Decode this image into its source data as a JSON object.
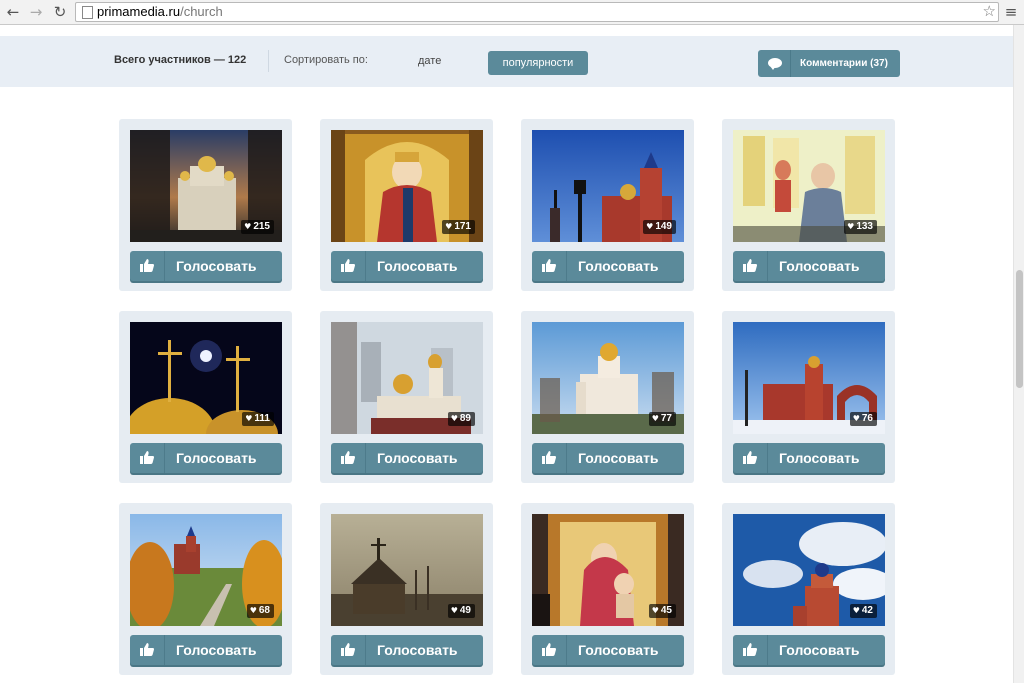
{
  "browser": {
    "url_domain": "primamedia.ru",
    "url_path": "/church",
    "back": "←",
    "forward": "→",
    "reload": "↻",
    "star": "☆",
    "menu": "≡"
  },
  "filters": {
    "total_participants": "Всего участников — 122",
    "sort_label": "Сортировать по:",
    "sort_date": "дате",
    "sort_popularity": "популярности",
    "comments_button": "Комментарии (37)"
  },
  "cards": [
    {
      "votes": "215",
      "vote_label": "Голосовать",
      "photo": "white cathedral with golden domes among bare trees at dusk"
    },
    {
      "votes": "171",
      "vote_label": "Голосовать",
      "photo": "golden icon of a saint with crown in red robe"
    },
    {
      "votes": "149",
      "vote_label": "Голосовать",
      "photo": "red brick church with blue domes and street lamp, blue sky"
    },
    {
      "votes": "133",
      "vote_label": "Голосовать",
      "photo": "bright iconostasis with child in foreground"
    },
    {
      "votes": "111",
      "vote_label": "Голосовать",
      "photo": "golden domes with crosses against night sky and moon"
    },
    {
      "votes": "89",
      "vote_label": "Голосовать",
      "photo": "church with golden domes among city buildings"
    },
    {
      "votes": "77",
      "vote_label": "Голосовать",
      "photo": "white church with golden dome and trees, blue sky"
    },
    {
      "votes": "76",
      "vote_label": "Голосовать",
      "photo": "red brick church in winter with arch, blue sky"
    },
    {
      "votes": "68",
      "vote_label": "Голосовать",
      "photo": "church in autumn forest landscape"
    },
    {
      "votes": "49",
      "vote_label": "Голосовать",
      "photo": "wooden chapel in sepia tones, cloudy sky"
    },
    {
      "votes": "45",
      "vote_label": "Голосовать",
      "photo": "icon of Virgin Mary with child in golden frame"
    },
    {
      "votes": "42",
      "vote_label": "Голосовать",
      "photo": "red brick bell tower with blue dome, clouds"
    }
  ],
  "colors": {
    "accent": "#5b8a9a",
    "filter_bar": "#e8eef5",
    "card_bg": "#e6ecf2"
  }
}
